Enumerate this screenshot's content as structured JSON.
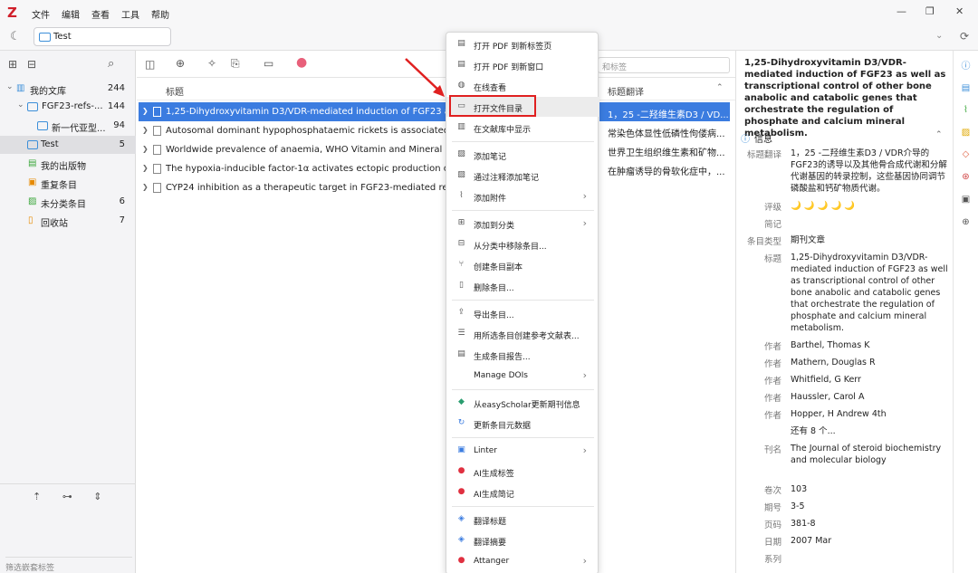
{
  "menubar": {
    "logo": "Z",
    "items": [
      "文件",
      "编辑",
      "查看",
      "工具",
      "帮助"
    ]
  },
  "tab": {
    "label": "Test"
  },
  "collections": [
    {
      "label": "我的文库",
      "count": "244",
      "level": 0,
      "expander": "⌄"
    },
    {
      "label": "FGF23-refs-...",
      "count": "144",
      "level": 1,
      "expander": "⌄"
    },
    {
      "label": "新一代亚型...",
      "count": "94",
      "level": 2,
      "expander": ""
    },
    {
      "label": "Test",
      "count": "5",
      "level": 0,
      "expander": "",
      "selected": true
    },
    {
      "label": "我的出版物",
      "count": "",
      "level": 0,
      "expander": ""
    },
    {
      "label": "重复条目",
      "count": "",
      "level": 0,
      "expander": ""
    },
    {
      "label": "未分类条目",
      "count": "6",
      "level": 0,
      "expander": ""
    },
    {
      "label": "回收站",
      "count": "7",
      "level": 0,
      "expander": ""
    }
  ],
  "tag_filter_placeholder": "筛选嵌套标签",
  "search_placeholder": "和标签",
  "columns": {
    "title": "标题",
    "translation": "标题翻译"
  },
  "items": [
    {
      "title": "1,25-Dihydroxyvitamin D3/VDR-mediated induction of FGF23 as w",
      "translation": "1，25 -二羟维生素D3 / VD...",
      "selected": true
    },
    {
      "title": "Autosomal dominant hypophosphataemic rickets is associated wit",
      "translation": "常染色体显性低磷性佝偻病..."
    },
    {
      "title": "Worldwide prevalence of anaemia, WHO Vitamin and Mineral Nutri",
      "translation": "世界卫生组织维生素和矿物..."
    },
    {
      "title": "The hypoxia-inducible factor-1α activates ectopic production of fib",
      "translation": "在肿瘤诱导的骨软化症中，..."
    },
    {
      "title": "CYP24 inhibition as a therapeutic target in FGF23-mediated renal p",
      "translation": ""
    }
  ],
  "context_menu": {
    "items": [
      {
        "label": "打开 PDF 到新标签页",
        "icon": "pdf-icon",
        "glyph": "▤"
      },
      {
        "label": "打开 PDF 到新窗口",
        "icon": "pdf-icon",
        "glyph": "▤"
      },
      {
        "label": "在线查看",
        "icon": "globe-icon",
        "glyph": "◍"
      },
      {
        "label": "打开文件目录",
        "icon": "folder-icon",
        "glyph": "▭",
        "highlighted": true
      },
      {
        "label": "在文献库中显示",
        "icon": "library-icon",
        "glyph": "▥"
      },
      {
        "label": "添加笔记",
        "icon": "note-icon",
        "glyph": "▨"
      },
      {
        "label": "通过注释添加笔记",
        "icon": "annotation-note-icon",
        "glyph": "▨"
      },
      {
        "label": "添加附件",
        "icon": "paperclip-icon",
        "glyph": "⌇",
        "submenu": true
      },
      {
        "label": "添加到分类",
        "icon": "add-collection-icon",
        "glyph": "⊞",
        "submenu": true
      },
      {
        "label": "从分类中移除条目...",
        "icon": "remove-collection-icon",
        "glyph": "⊟"
      },
      {
        "label": "创建条目副本",
        "icon": "duplicate-icon",
        "glyph": "⑂"
      },
      {
        "label": "删除条目...",
        "icon": "trash-icon",
        "glyph": "▯"
      },
      {
        "label": "导出条目...",
        "icon": "export-icon",
        "glyph": "⇪"
      },
      {
        "label": "用所选条目创建参考文献表...",
        "icon": "bibliography-icon",
        "glyph": "☰"
      },
      {
        "label": "生成条目报告...",
        "icon": "report-icon",
        "glyph": "▤"
      },
      {
        "label": "Manage DOIs",
        "icon": "",
        "glyph": "",
        "submenu": true
      },
      {
        "label": "从easyScholar更新期刊信息",
        "icon": "easyscholar-icon",
        "glyph": "◆"
      },
      {
        "label": "更新条目元数据",
        "icon": "refresh-icon",
        "glyph": "↻"
      },
      {
        "label": "Linter",
        "icon": "linter-icon",
        "glyph": "▣",
        "submenu": true
      },
      {
        "label": "AI生成标签",
        "icon": "ai-tag-icon",
        "glyph": "●"
      },
      {
        "label": "AI生成简记",
        "icon": "ai-note-icon",
        "glyph": "●"
      },
      {
        "label": "翻译标题",
        "icon": "translate-icon",
        "glyph": "◈"
      },
      {
        "label": "翻译摘要",
        "icon": "translate-icon",
        "glyph": "◈"
      },
      {
        "label": "Attanger",
        "icon": "attanger-icon",
        "glyph": "●",
        "submenu": true
      }
    ]
  },
  "detail": {
    "title": "1,25-Dihydroxyvitamin D3/VDR-mediated induction of FGF23 as well as transcriptional control of other bone anabolic and catabolic genes that orchestrate the regulation of phosphate and calcium mineral metabolism.",
    "section_info": "信息",
    "fields": [
      {
        "label": "标题翻译",
        "value": "1，25 -二羟维生素D3 / VDR介导的FGF23的诱导以及其他骨合成代谢和分解代谢基因的转录控制，这些基因协同调节磷酸盐和钙矿物质代谢。",
        "lines": 4
      },
      {
        "label": "评级",
        "value": "🌙 🌙 🌙 🌙 🌙",
        "lines": 1
      },
      {
        "label": "简记",
        "value": "",
        "lines": 1
      },
      {
        "label": "条目类型",
        "value": "期刊文章",
        "lines": 1
      },
      {
        "label": "标题",
        "value": "1,25-Dihydroxyvitamin D3/VDR-mediated induction of FGF23 as well as transcriptional control of other bone anabolic and catabolic genes that orchestrate the regulation of phosphate and calcium mineral metabolism.",
        "lines": 7
      },
      {
        "label": "作者",
        "value": "Barthel, Thomas K",
        "lines": 1
      },
      {
        "label": "作者",
        "value": "Mathern, Douglas R",
        "lines": 1
      },
      {
        "label": "作者",
        "value": "Whitfield, G Kerr",
        "lines": 1
      },
      {
        "label": "作者",
        "value": "Haussler, Carol A",
        "lines": 1
      },
      {
        "label": "作者",
        "value": "Hopper, H Andrew 4th",
        "lines": 1
      },
      {
        "label": "",
        "value": "还有 8 个...",
        "lines": 1
      },
      {
        "label": "刊名",
        "value": "The Journal of steroid biochemistry and molecular biology",
        "lines": 3
      },
      {
        "label": "卷次",
        "value": "103",
        "lines": 1
      },
      {
        "label": "期号",
        "value": "3-5",
        "lines": 1
      },
      {
        "label": "页码",
        "value": "381-8",
        "lines": 1
      },
      {
        "label": "日期",
        "value": "2007 Mar",
        "lines": 1
      },
      {
        "label": "系列",
        "value": "",
        "lines": 1
      }
    ]
  },
  "colors": {
    "accent": "#3b7ce0",
    "highlight_box": "#e02020",
    "logo": "#d0202b"
  }
}
